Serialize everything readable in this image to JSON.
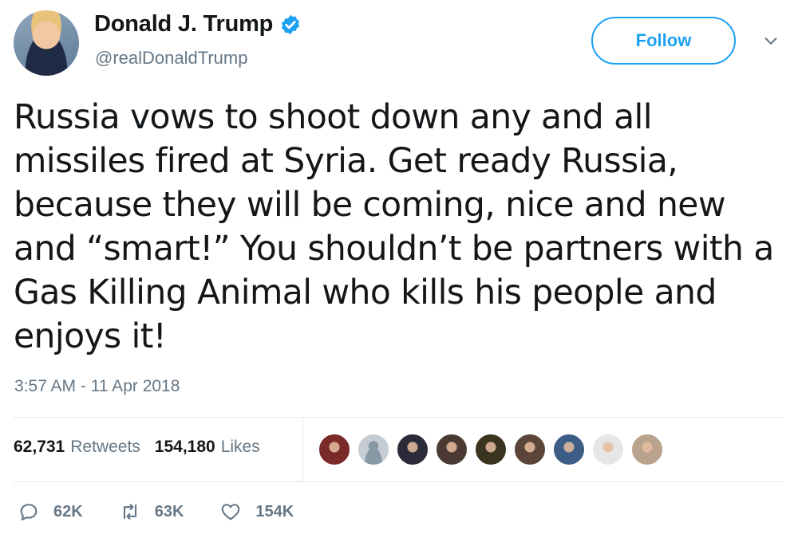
{
  "user": {
    "display_name": "Donald J. Trump",
    "handle": "@realDonaldTrump",
    "verified_icon": "verified-badge-icon",
    "follow_label": "Follow"
  },
  "tweet": {
    "text": "Russia vows to shoot down any and all\nmissiles fired at Syria. Get ready Russia,\nbecause they will be coming, nice and new\nand “smart!” You shouldn’t be partners with a\nGas Killing Animal who kills his people and\nenjoys it!",
    "timestamp": "3:57 AM - 11 Apr 2018"
  },
  "stats": {
    "retweets_count": "62,731",
    "retweets_label": "Retweets",
    "likes_count": "154,180",
    "likes_label": "Likes"
  },
  "liked_by_avatars": [
    {
      "icon": "user-avatar",
      "color": "#7a2a28"
    },
    {
      "icon": "default-avatar",
      "color": "#c5ccd3"
    },
    {
      "icon": "user-avatar",
      "color": "#2b2b3a"
    },
    {
      "icon": "user-avatar",
      "color": "#4b3a33"
    },
    {
      "icon": "user-avatar",
      "color": "#3a3320"
    },
    {
      "icon": "user-avatar",
      "color": "#5a4538"
    },
    {
      "icon": "user-avatar",
      "color": "#3e5d86"
    },
    {
      "icon": "user-avatar",
      "color": "#e6e6e6"
    },
    {
      "icon": "user-avatar",
      "color": "#b9a38c"
    }
  ],
  "actions": {
    "replies": "62K",
    "retweets": "63K",
    "likes": "154K"
  },
  "colors": {
    "accent": "#1da1f2",
    "secondary_text": "#657786",
    "divider": "#e1e8ed"
  }
}
